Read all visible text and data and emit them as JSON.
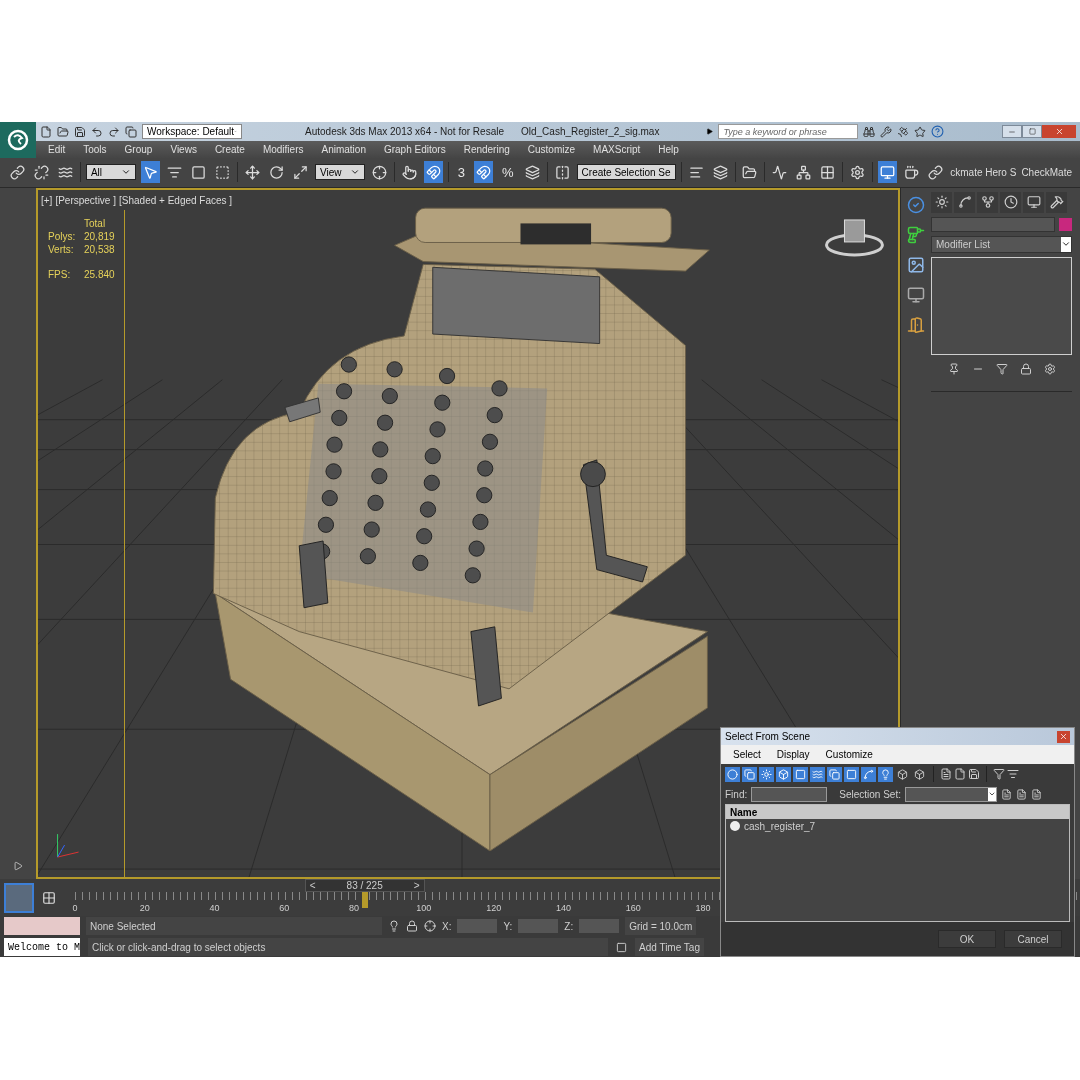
{
  "window": {
    "app_title": "Autodesk 3ds Max  2013 x64  - Not for Resale",
    "file_name": "Old_Cash_Register_2_sig.max"
  },
  "workspace": "Workspace: Default",
  "search": {
    "placeholder": "Type a keyword or phrase"
  },
  "menus": [
    "Edit",
    "Tools",
    "Group",
    "Views",
    "Create",
    "Modifiers",
    "Animation",
    "Graph Editors",
    "Rendering",
    "Customize",
    "MAXScript",
    "Help"
  ],
  "toolbar": [
    {
      "kind": "button",
      "on": false
    },
    {
      "kind": "button",
      "on": false
    },
    {
      "kind": "button",
      "on": false
    },
    {
      "kind": "separator"
    },
    {
      "kind": "dropdown",
      "value": "All"
    },
    {
      "kind": "button",
      "on": true
    },
    {
      "kind": "button",
      "on": false
    },
    {
      "kind": "button",
      "on": false
    },
    {
      "kind": "button",
      "on": false
    },
    {
      "kind": "separator"
    },
    {
      "kind": "button",
      "on": false
    },
    {
      "kind": "button",
      "on": false
    },
    {
      "kind": "button",
      "on": false
    },
    {
      "kind": "dropdown",
      "value": "View"
    },
    {
      "kind": "button",
      "on": false
    },
    {
      "kind": "separator"
    },
    {
      "kind": "button",
      "on": false
    },
    {
      "kind": "button",
      "on": true
    },
    {
      "kind": "separator"
    },
    {
      "kind": "glyph",
      "label": "3",
      "on": false
    },
    {
      "kind": "button",
      "on": true
    },
    {
      "kind": "glyph",
      "label": "%",
      "on": false
    },
    {
      "kind": "button",
      "on": false
    },
    {
      "kind": "separator"
    },
    {
      "kind": "button",
      "on": false
    },
    {
      "kind": "dropdown",
      "value": "Create Selection Se"
    },
    {
      "kind": "separator"
    },
    {
      "kind": "button",
      "on": false
    },
    {
      "kind": "button",
      "on": false
    },
    {
      "kind": "separator"
    },
    {
      "kind": "button",
      "on": false
    },
    {
      "kind": "separator"
    },
    {
      "kind": "button",
      "on": false
    },
    {
      "kind": "button",
      "on": false
    },
    {
      "kind": "button",
      "on": false
    },
    {
      "kind": "separator"
    },
    {
      "kind": "button",
      "on": false
    },
    {
      "kind": "separator"
    },
    {
      "kind": "button",
      "on": true
    },
    {
      "kind": "button",
      "on": false
    },
    {
      "kind": "button",
      "on": false
    },
    {
      "kind": "text",
      "label": "ckmate Hero S"
    },
    {
      "kind": "text",
      "label": "CheckMate"
    }
  ],
  "viewport": {
    "labels": [
      "[+]",
      "[Perspective ]",
      "[Shaded + Edged Faces ]"
    ],
    "stats": {
      "header": "Total",
      "rows": [
        {
          "label": "Polys:",
          "value": "20,819"
        },
        {
          "label": "Verts:",
          "value": "20,538"
        }
      ],
      "fps_label": "FPS:",
      "fps_value": "25.840"
    }
  },
  "command_panel": {
    "modifier_list": "Modifier List"
  },
  "time_slider": {
    "prev": "<",
    "frame": "83 / 225",
    "next": ">",
    "level": 0.369
  },
  "track_bar": {
    "ticks": [
      "0",
      "20",
      "40",
      "60",
      "80",
      "100",
      "120",
      "140",
      "160",
      "180"
    ]
  },
  "status": {
    "selection": "None Selected",
    "x_label": "X:",
    "y_label": "Y:",
    "z_label": "Z:",
    "grid": "Grid = 10.0cm",
    "prompt": "Click or click-and-drag to select objects",
    "time_tag": "Add Time Tag",
    "listener": "Welcome to M"
  },
  "dialog": {
    "title": "Select From Scene",
    "menus": [
      "Select",
      "Display",
      "Customize"
    ],
    "tools": [
      {
        "on": true
      },
      {
        "on": true
      },
      {
        "on": true
      },
      {
        "on": true
      },
      {
        "on": true
      },
      {
        "on": true
      },
      {
        "on": true
      },
      {
        "on": true
      },
      {
        "on": true
      },
      {
        "on": true
      },
      {
        "on": false
      },
      {
        "on": false
      }
    ],
    "find_label": "Find:",
    "selection_set_label": "Selection Set:",
    "column": "Name",
    "rows": [
      {
        "name": "cash_register_7",
        "selected": false
      }
    ],
    "buttons": [
      "OK",
      "Cancel"
    ]
  }
}
